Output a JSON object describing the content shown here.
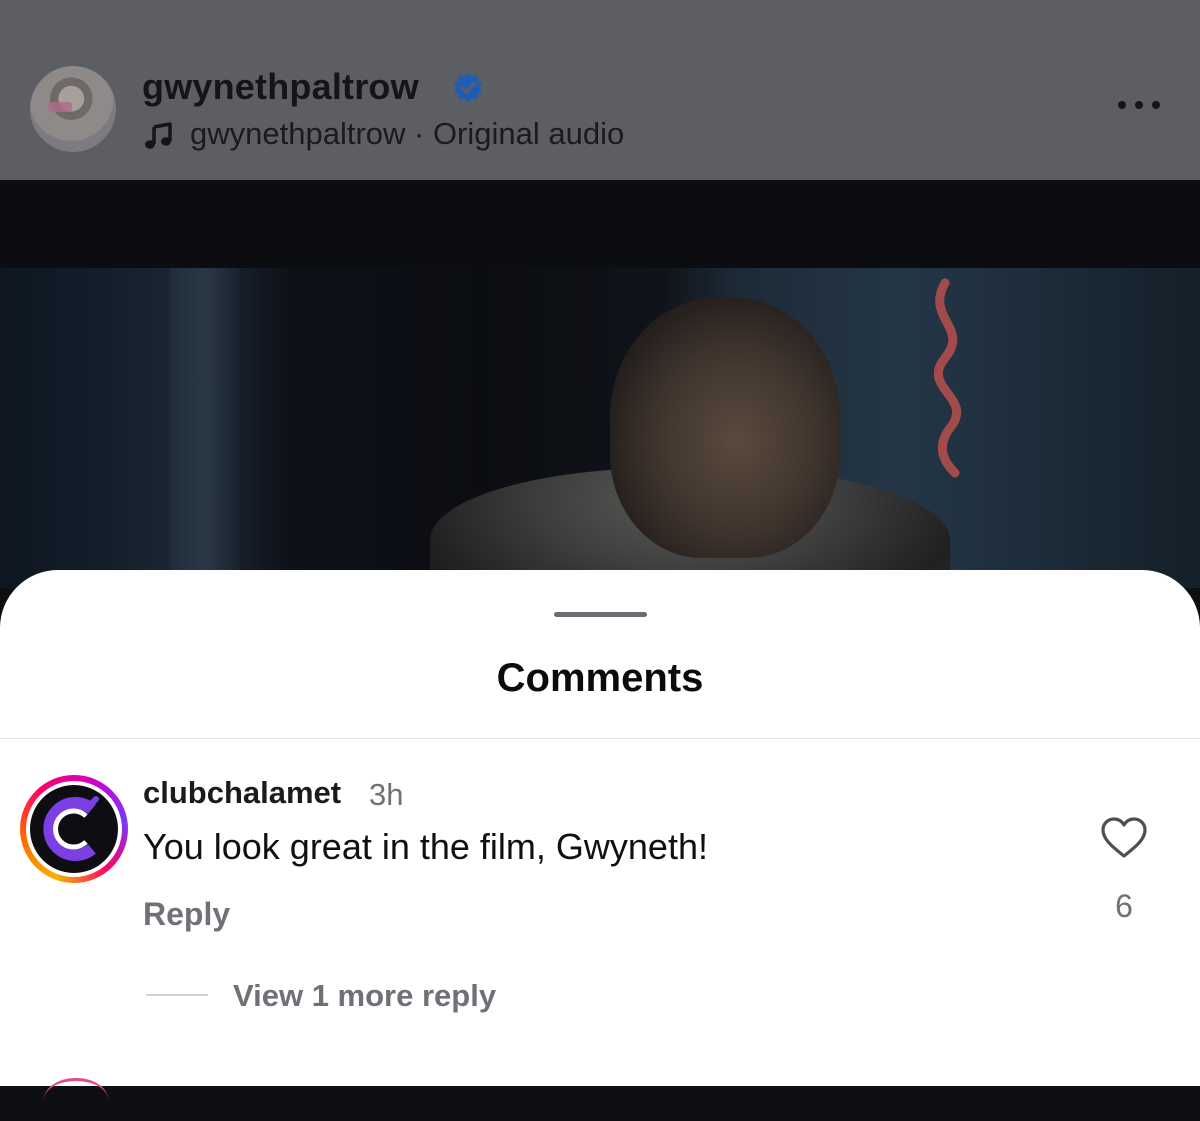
{
  "header": {
    "username": "gwynethpaltrow",
    "audio_label": "gwynethpaltrow · Original audio",
    "icons": [
      "verified-badge-icon",
      "music-note-icon",
      "more-options-icon"
    ]
  },
  "sheet": {
    "title": "Comments"
  },
  "comments": [
    {
      "username": "clubchalamet",
      "time": "3h",
      "text": "You look great in the film, Gwyneth!",
      "reply_label": "Reply",
      "likes": "6",
      "view_replies_label": "View 1 more reply"
    }
  ],
  "colors": {
    "verified_blue": "#0095f6",
    "sheet_background": "#ffffff",
    "muted_text": "#6f7176"
  }
}
